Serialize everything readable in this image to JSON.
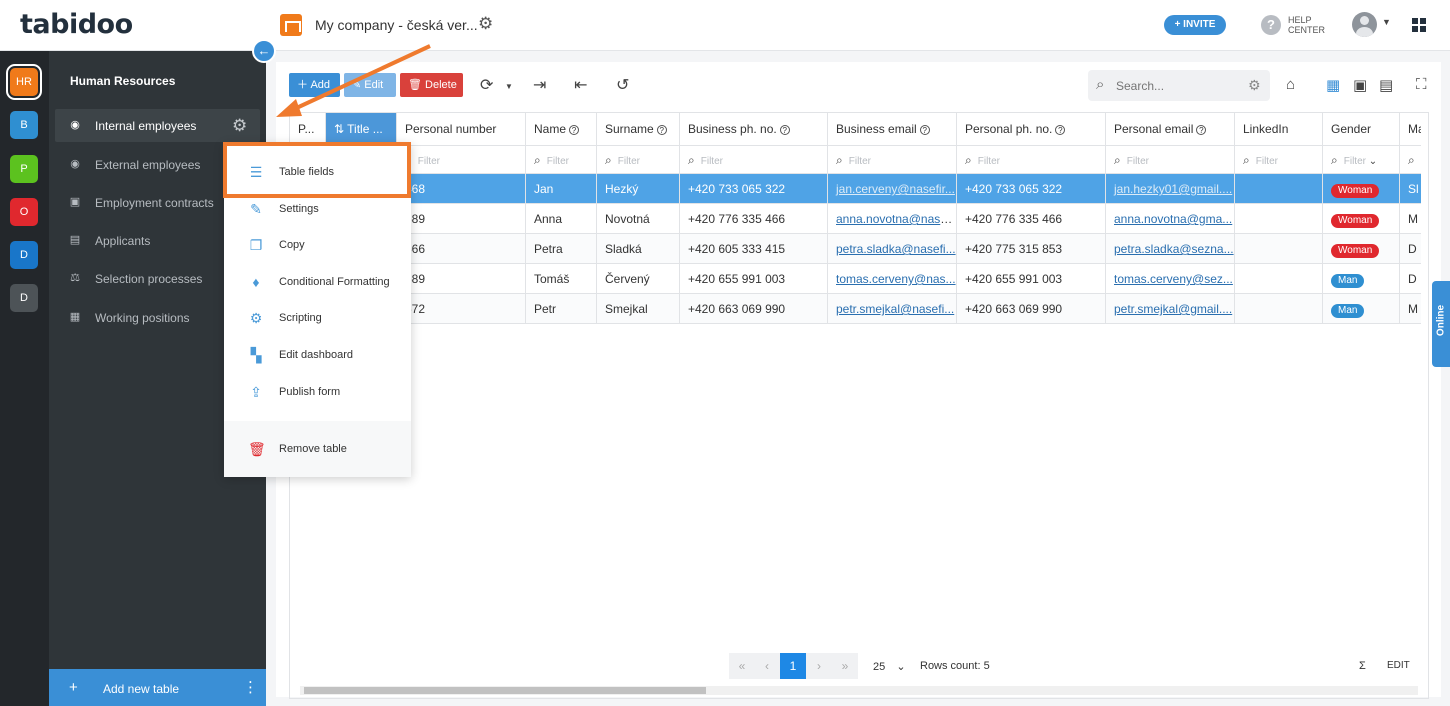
{
  "header": {
    "logo": "tabidoo",
    "workspace_title": "My company - česká ver...",
    "invite_label": "+ INVITE",
    "help_label": "HELP CENTER"
  },
  "rail": [
    {
      "label": "HR",
      "color": "#f07a1a"
    },
    {
      "label": "B",
      "color": "#2f8fd1"
    },
    {
      "label": "P",
      "color": "#5cc21f"
    },
    {
      "label": "O",
      "color": "#e0282e"
    },
    {
      "label": "D",
      "color": "#1976c9"
    },
    {
      "label": "D",
      "color": "#4d5357"
    }
  ],
  "sidebar": {
    "title": "Human Resources",
    "items": [
      {
        "label": "Internal employees",
        "icon": "person-circle-icon"
      },
      {
        "label": "External employees",
        "icon": "person-circle-icon"
      },
      {
        "label": "Employment contracts",
        "icon": "contract-icon"
      },
      {
        "label": "Applicants",
        "icon": "applicant-icon"
      },
      {
        "label": "Selection processes",
        "icon": "scales-icon"
      },
      {
        "label": "Working positions",
        "icon": "grid-icon"
      }
    ],
    "add_table_label": "Add new table"
  },
  "toolbar": {
    "add_label": "Add",
    "edit_label": "Edit",
    "delete_label": "Delete",
    "search_placeholder": "Search..."
  },
  "table": {
    "columns": [
      "P...",
      "Title ...",
      "Personal number",
      "Name",
      "Surname",
      "Business ph. no.",
      "Business email",
      "Personal ph. no.",
      "Personal email",
      "LinkedIn",
      "Gender",
      "Mari"
    ],
    "filter_placeholder": "Filter",
    "rows": [
      {
        "personal_number": "468",
        "name": "Jan",
        "surname": "Hezký",
        "business_phone": "+420 733 065 322",
        "business_email": "jan.cerveny@nasefir...",
        "personal_phone": "+420 733 065 322",
        "personal_email": "jan.hezky01@gmail....",
        "gender": "Woman",
        "marital": "Sl"
      },
      {
        "personal_number": "689",
        "name": "Anna",
        "surname": "Novotná",
        "business_phone": "+420 776 335 466",
        "business_email": "anna.novotna@nase...",
        "personal_phone": "+420 776 335 466",
        "personal_email": "anna.novotna@gma...",
        "gender": "Woman",
        "marital": "M"
      },
      {
        "personal_number": "566",
        "name": "Petra",
        "surname": "Sladká",
        "business_phone": "+420 605 333 415",
        "business_email": "petra.sladka@nasefi...",
        "personal_phone": "+420 775 315 853",
        "personal_email": "petra.sladka@sezna...",
        "gender": "Woman",
        "marital": "D"
      },
      {
        "personal_number": "689",
        "name": "Tomáš",
        "surname": "Červený",
        "business_phone": "+420 655 991 003",
        "business_email": "tomas.cerveny@nas...",
        "personal_phone": "+420 655 991 003",
        "personal_email": "tomas.cerveny@sez...",
        "gender": "Man",
        "marital": "D"
      },
      {
        "personal_number": "672",
        "name": "Petr",
        "surname": "Smejkal",
        "business_phone": "+420 663 069 990",
        "business_email": "petr.smejkal@nasefi...",
        "personal_phone": "+420 663 069 990",
        "personal_email": "petr.smejkal@gmail....",
        "gender": "Man",
        "marital": "M"
      }
    ]
  },
  "footer": {
    "current_page": "1",
    "page_size": "25",
    "rows_count": "Rows count: 5",
    "sum_symbol": "Σ",
    "edit_label": "EDIT"
  },
  "context_menu": {
    "items": [
      {
        "label": "Table fields",
        "icon": "list-icon"
      },
      {
        "label": "Settings",
        "icon": "pencil-icon"
      },
      {
        "label": "Copy",
        "icon": "copy-icon"
      },
      {
        "label": "Conditional Formatting",
        "icon": "paint-icon"
      },
      {
        "label": "Scripting",
        "icon": "script-gear-icon"
      },
      {
        "label": "Edit dashboard",
        "icon": "dashboard-icon"
      },
      {
        "label": "Publish form",
        "icon": "upload-icon"
      }
    ],
    "remove_label": "Remove table"
  },
  "online_label": "Online"
}
